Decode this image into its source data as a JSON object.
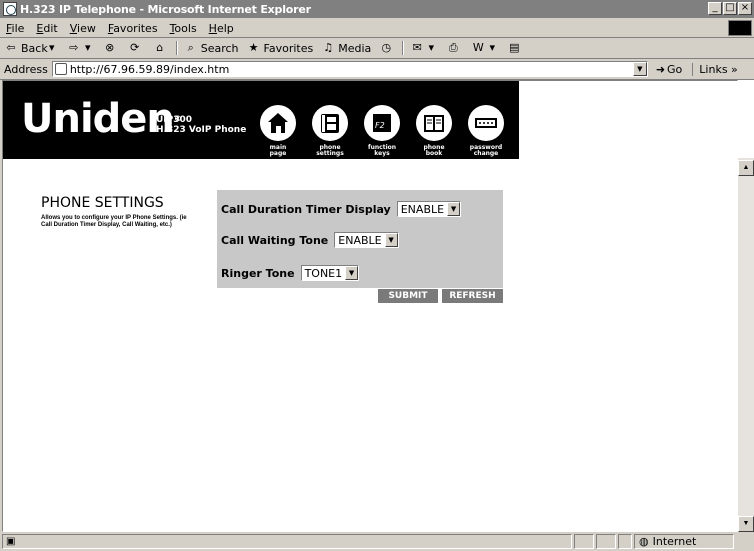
{
  "window": {
    "title": "H.323 IP Telephone - Microsoft Internet Explorer",
    "buttons": [
      "_",
      "□",
      "×"
    ]
  },
  "menu": [
    "File",
    "Edit",
    "View",
    "Favorites",
    "Tools",
    "Help"
  ],
  "toolbar": {
    "back": "Back",
    "search": "Search",
    "favorites": "Favorites",
    "media": "Media"
  },
  "address": {
    "label": "Address",
    "url": "http://67.96.59.89/index.htm",
    "go": "Go",
    "links": "Links »"
  },
  "banner": {
    "brand": "Uniden",
    "model_line1": "UIP300",
    "model_line2": "H.323 VoIP Phone",
    "nav": [
      {
        "label": "main\npage",
        "icon": "home-icon"
      },
      {
        "label": "phone\nsettings",
        "icon": "phone-icon"
      },
      {
        "label": "function\nkeys",
        "icon": "function-key-icon"
      },
      {
        "label": "phone\nbook",
        "icon": "book-icon"
      },
      {
        "label": "password\nchange",
        "icon": "password-icon"
      }
    ]
  },
  "page": {
    "heading": "PHONE SETTINGS",
    "description": "Allows you to configure your IP Phone Settings. (ie Call Duration Timer Display, Call Waiting, etc.)"
  },
  "settings": {
    "call_duration": {
      "label": "Call Duration Timer Display",
      "value": "ENABLE"
    },
    "call_waiting": {
      "label": "Call Waiting Tone",
      "value": "ENABLE"
    },
    "ringer": {
      "label": "Ringer Tone",
      "value": "TONE1"
    }
  },
  "actions": {
    "submit": "SUBMIT",
    "refresh": "REFRESH"
  },
  "status": {
    "zone": "Internet"
  }
}
